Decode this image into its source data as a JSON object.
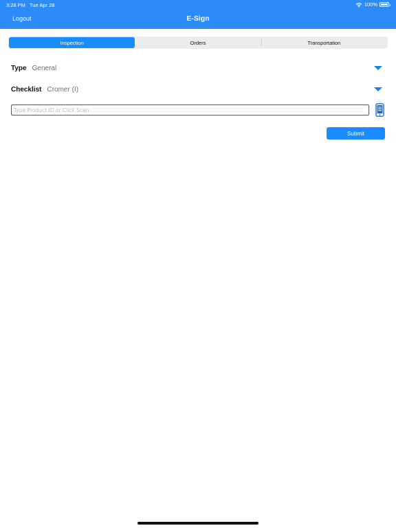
{
  "status_bar": {
    "time": "3:28 PM",
    "date": "Tue Apr 28",
    "battery": "100%"
  },
  "nav": {
    "logout_label": "Logout",
    "title": "E-Sign"
  },
  "tabs": [
    {
      "label": "Inspection",
      "active": true
    },
    {
      "label": "Orders",
      "active": false
    },
    {
      "label": "Transportation",
      "active": false
    }
  ],
  "form": {
    "type": {
      "label": "Type",
      "value": "General"
    },
    "checklist": {
      "label": "Checklist",
      "value": "Cromer (I)"
    },
    "product_input": {
      "value": "",
      "placeholder": "Type Product ID or Click Scan"
    },
    "scan_icon": "phone-scan-icon",
    "submit_label": "Submit"
  },
  "colors": {
    "accent": "#1a8cff",
    "header": "#2d8bf7"
  }
}
